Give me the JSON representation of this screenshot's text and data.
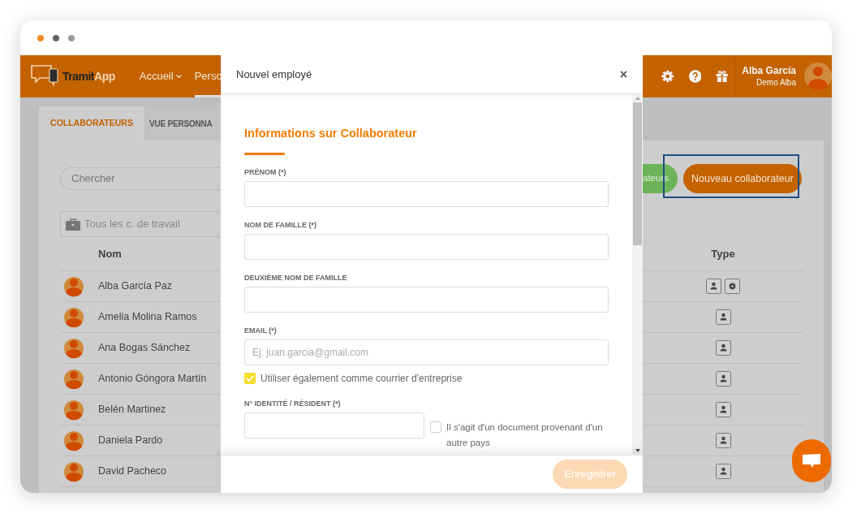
{
  "app": {
    "logo": {
      "bold_part": "Tramit",
      "light_part": "App"
    },
    "nav_items": [
      {
        "label": "Accueil",
        "kind": "dropdown",
        "selected": false
      },
      {
        "label": "Perso",
        "kind": "link",
        "selected": true
      }
    ],
    "user": {
      "name": "Alba García",
      "subtitle": "Demo Alba"
    }
  },
  "tabs": [
    {
      "label": "COLLABORATEURS",
      "selected": true
    },
    {
      "label": "VUE PERSONNA",
      "selected": false
    }
  ],
  "search": {
    "placeholder": "Chercher"
  },
  "workplace_filter": {
    "placeholder": "Tous les c. de travail"
  },
  "buttons": [
    {
      "label": "ateurs",
      "kind": "secondary"
    },
    {
      "label": "Nouveau collaborateur",
      "kind": "primary",
      "highlighted": true
    }
  ],
  "table": {
    "columns": [
      "Nom",
      "Type"
    ],
    "rows": [
      {
        "name": "Alba García Paz",
        "type_icons": [
          {
            "kind": "user"
          },
          {
            "kind": "admin"
          }
        ]
      },
      {
        "name": "Amelia Molina Ramos",
        "type_icons": [
          {
            "kind": "user"
          }
        ]
      },
      {
        "name": "Ana Bogas Sánchez",
        "type_icons": [
          {
            "kind": "user"
          }
        ]
      },
      {
        "name": "Antonio Góngora Martín",
        "type_icons": [
          {
            "kind": "user"
          }
        ]
      },
      {
        "name": "Belén Martinez",
        "type_icons": [
          {
            "kind": "user"
          }
        ]
      },
      {
        "name": "Daniela Pardo",
        "type_icons": [
          {
            "kind": "user"
          }
        ]
      },
      {
        "name": "David Pacheco",
        "type_icons": [
          {
            "kind": "user"
          }
        ]
      }
    ]
  },
  "modal": {
    "title": "Nouvel employé",
    "close_label": "×",
    "section_title": "Informations sur Collaborateur",
    "fields": [
      {
        "label": "PRÉNOM (*)",
        "kind": "text"
      },
      {
        "label": "NOM DE FAMILLE (*)",
        "kind": "text"
      },
      {
        "label": "DEUXIÈME NOM DE FAMILLE",
        "kind": "text"
      },
      {
        "label": "EMAIL (*)",
        "kind": "text",
        "placeholder": "Ej: juan.garcia@gmail.com",
        "option": {
          "label": "Utiliser également comme courrier d'entreprise",
          "checked": true
        }
      },
      {
        "label": "N° IDENTITÉ / RÉSIDENT (*)",
        "kind": "text_with_check",
        "option": {
          "label": "Il s'agit d'un document provenant d'un autre pays",
          "checked": false
        }
      }
    ],
    "save_button": {
      "label": "Enregistrer",
      "disabled": true
    }
  }
}
